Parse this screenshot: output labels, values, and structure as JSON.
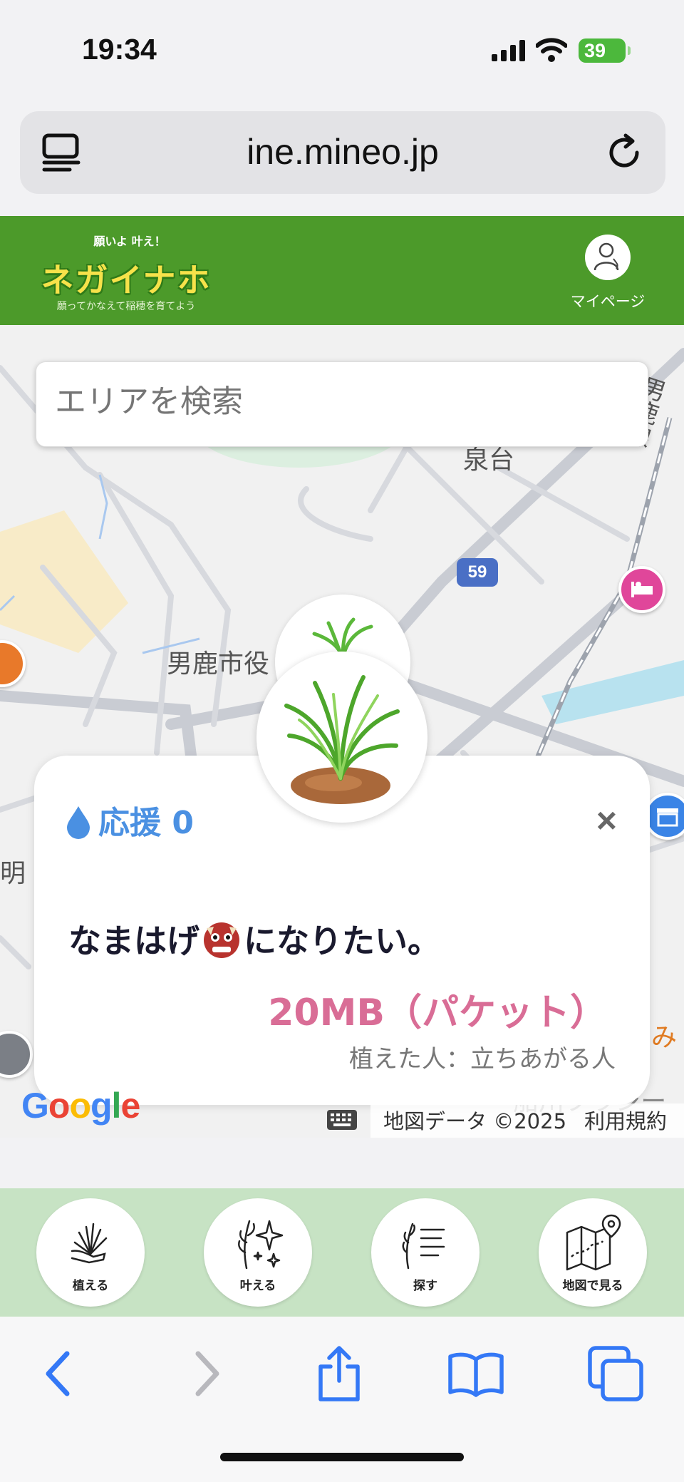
{
  "status_bar": {
    "time": "19:34",
    "battery": "39"
  },
  "browser": {
    "url": "ine.mineo.jp"
  },
  "header": {
    "logo_top": "願いよ 叶え！",
    "logo_main": "ネガイナホ",
    "logo_sub": "願ってかなえて稲穂を育てよう",
    "mypage_label": "マイページ"
  },
  "search": {
    "placeholder": "エリアを検索"
  },
  "map": {
    "labels": {
      "station_area": "泉台",
      "rail_line": "男鹿線",
      "city_hall": "男鹿市役",
      "shrine_area": "明",
      "right_edge": "み",
      "bottom_street": "船川プラシー"
    },
    "route_number": "59",
    "google": "Google",
    "map_data": "地図データ ©2025",
    "terms": "利用規約"
  },
  "card": {
    "support_label": "応援 0",
    "close": "×",
    "wish_before": "なまはげ",
    "wish_after": "になりたい。",
    "data_amount": "20MB（パケット）",
    "planter": "植えた人：立ちあがる人"
  },
  "bottom_nav": [
    {
      "label": "植える",
      "icon": "plant-hand-icon"
    },
    {
      "label": "叶える",
      "icon": "sparkle-rice-icon"
    },
    {
      "label": "探す",
      "icon": "list-rice-icon"
    },
    {
      "label": "地図で見る",
      "icon": "map-pin-icon"
    }
  ],
  "colors": {
    "header_green": "#4c9a2a",
    "nav_green": "#c7e3c4",
    "support_blue": "#4a90e2",
    "data_pink": "#d96d96",
    "ios_blue": "#3478f6"
  }
}
